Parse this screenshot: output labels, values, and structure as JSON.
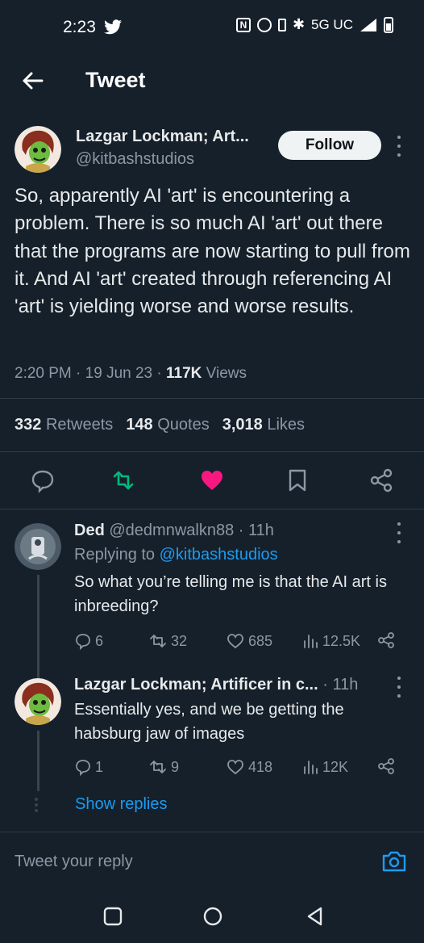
{
  "status_bar": {
    "time": "2:23",
    "network": "5G UC"
  },
  "header": {
    "title": "Tweet"
  },
  "tweet": {
    "author_name": "Lazgar Lockman; Art...",
    "handle": "@kitbashstudios",
    "follow_label": "Follow",
    "text": "So, apparently AI 'art' is encountering a problem.  There is so much AI 'art' out there that the programs are now starting to pull from it.  And AI 'art' created through referencing AI 'art' is yielding worse and worse results.",
    "time": "2:20 PM",
    "date": "19 Jun 23",
    "views_count": "117K",
    "views_label": "Views",
    "retweets_count": "332",
    "retweets_label": "Retweets",
    "quotes_count": "148",
    "quotes_label": "Quotes",
    "likes_count": "3,018",
    "likes_label": "Likes"
  },
  "replies": [
    {
      "name": "Ded",
      "handle": "@dedmnwalkn88",
      "age": "11h",
      "replying_prefix": "Replying to",
      "replying_to": "@kitbashstudios",
      "text": "So what you’re telling me is that the AI art is inbreeding?",
      "replies": "6",
      "retweets": "32",
      "likes": "685",
      "views": "12.5K"
    },
    {
      "name": "Lazgar Lockman; Artificer in c...",
      "age": "11h",
      "text": "Essentially yes, and we be getting the habsburg jaw of images",
      "replies": "1",
      "retweets": "9",
      "likes": "418",
      "views": "12K"
    }
  ],
  "show_replies": "Show replies",
  "reply_box": {
    "placeholder": "Tweet your reply"
  },
  "colors": {
    "background": "#15202b",
    "accent": "#1d9bf0",
    "like": "#f91880",
    "retweet": "#00ba7c"
  }
}
